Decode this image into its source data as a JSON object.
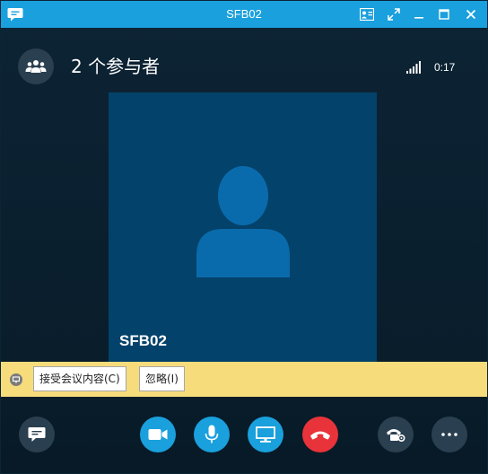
{
  "window": {
    "title": "SFB02"
  },
  "header": {
    "participants_text": "2 个参与者",
    "duration": "0:17"
  },
  "video": {
    "participant_name": "SFB02"
  },
  "notification": {
    "accept_label": "接受会议内容(C)",
    "ignore_label": "忽略(I)"
  },
  "controls": {
    "items": [
      "chat",
      "video",
      "microphone",
      "present",
      "hang-up",
      "call-controls",
      "more"
    ]
  },
  "colors": {
    "accent": "#1aa0dd",
    "hangup": "#e8333a",
    "notification": "#f7dc7c",
    "tile": "#03426a"
  }
}
